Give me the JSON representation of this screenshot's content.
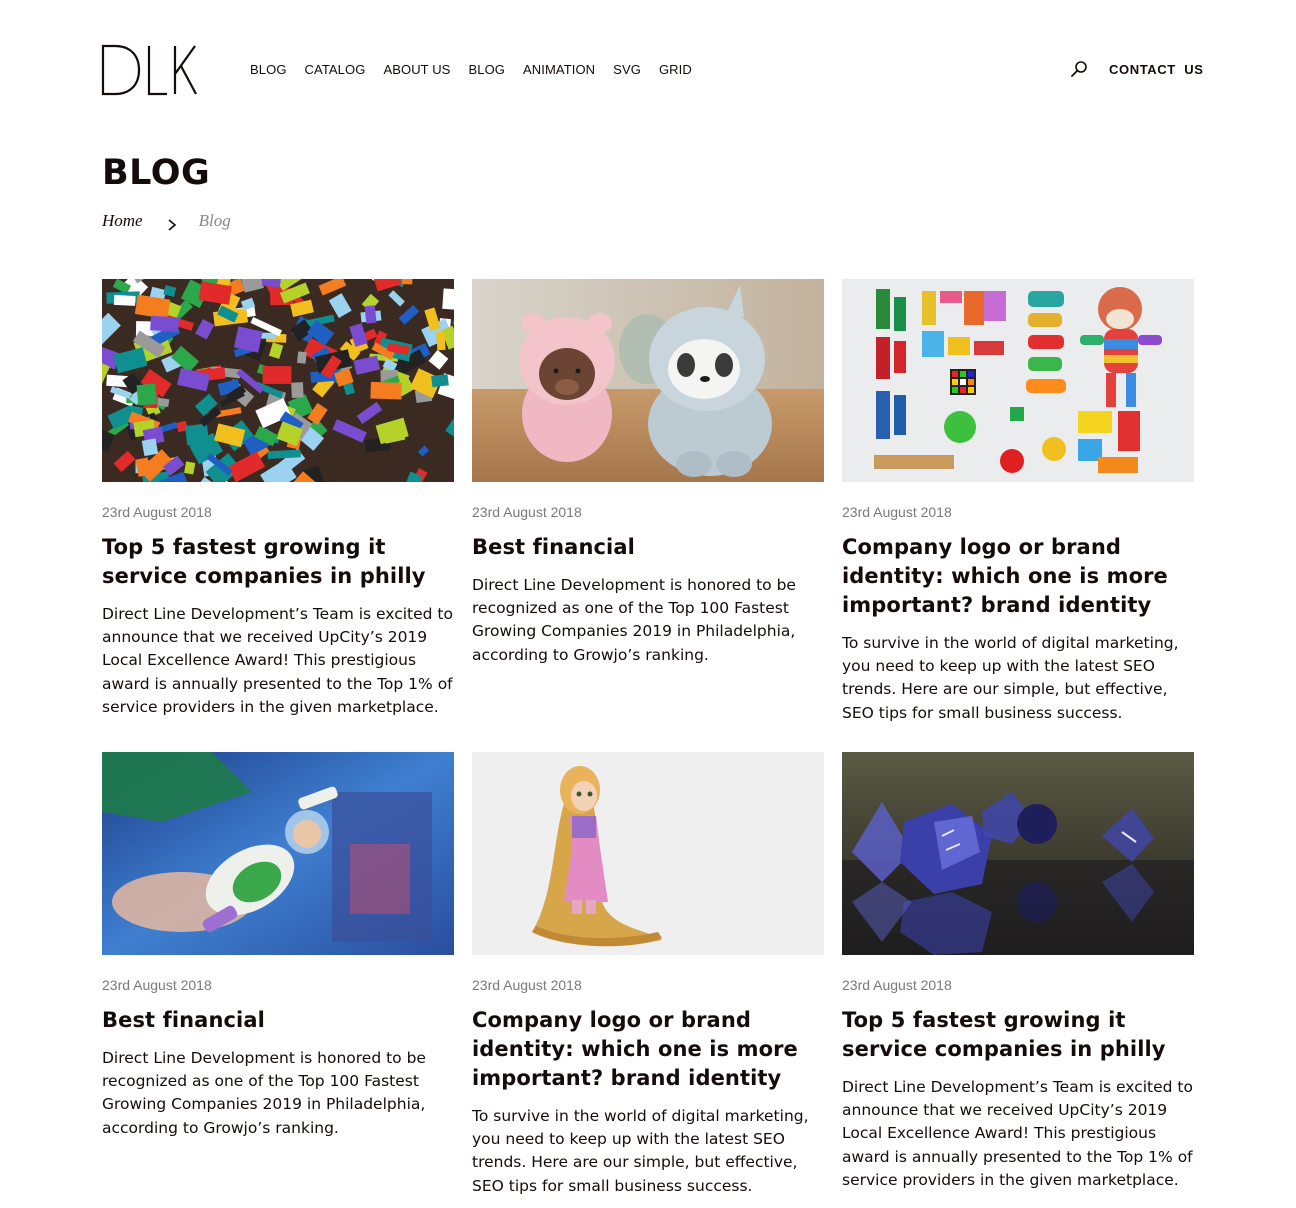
{
  "header": {
    "logo_text": "DLK",
    "nav": [
      "BLOG",
      "CATALOG",
      "ABOUT US",
      "BLOG",
      "ANIMATION",
      "SVG",
      "GRID"
    ],
    "search_icon": "search-icon",
    "contact_label": "CONTACT  US"
  },
  "page": {
    "title": "BLOG",
    "breadcrumb": {
      "home": "Home",
      "separator_icon": "chevron-right-icon",
      "current": "Blog"
    }
  },
  "posts": [
    {
      "image": "lego-bricks-pile",
      "date": "23rd August 2018",
      "title": "Top 5 fastest growing it service companies in philly",
      "excerpt": "Direct Line Development’s Team is excited to announce that we received UpCity’s 2019 Local Excellence Award! This prestigious award is annually presented to the Top 1% of service providers in the given marketplace."
    },
    {
      "image": "bear-figurines",
      "date": "23rd August 2018",
      "title": "Best financial",
      "excerpt": "Direct Line Development is honored to be recognized as one of the Top 100 Fastest Growing Companies 2019 in Philadelphia, according to Growjo’s ranking."
    },
    {
      "image": "toys-flatlay",
      "date": "23rd August 2018",
      "title": "Company logo or brand identity: which one is more important? brand identity",
      "excerpt": "To survive in the world of digital marketing, you need to keep up with the latest SEO trends. Here are our simple, but effective, SEO tips for small business success."
    },
    {
      "image": "space-ranger-toy",
      "date": "23rd August 2018",
      "title": "Best financial",
      "excerpt": "Direct Line Development is honored to be recognized as one of the Top 100 Fastest Growing Companies 2019 in Philadelphia, according to Growjo’s ranking."
    },
    {
      "image": "princess-figurine",
      "date": "23rd August 2018",
      "title": "Company logo or brand identity: which one is more important? brand identity",
      "excerpt": "To survive in the world of digital marketing, you need to keep up with the latest SEO trends. Here are our simple, but effective, SEO tips for small business success."
    },
    {
      "image": "blue-dice",
      "date": "23rd August 2018",
      "title": "Top 5 fastest growing it service companies in philly",
      "excerpt": "Direct Line Development’s Team is excited to announce that we received UpCity’s 2019 Local Excellence Award! This prestigious award is annually presented to the Top 1% of service providers in the given marketplace."
    }
  ]
}
